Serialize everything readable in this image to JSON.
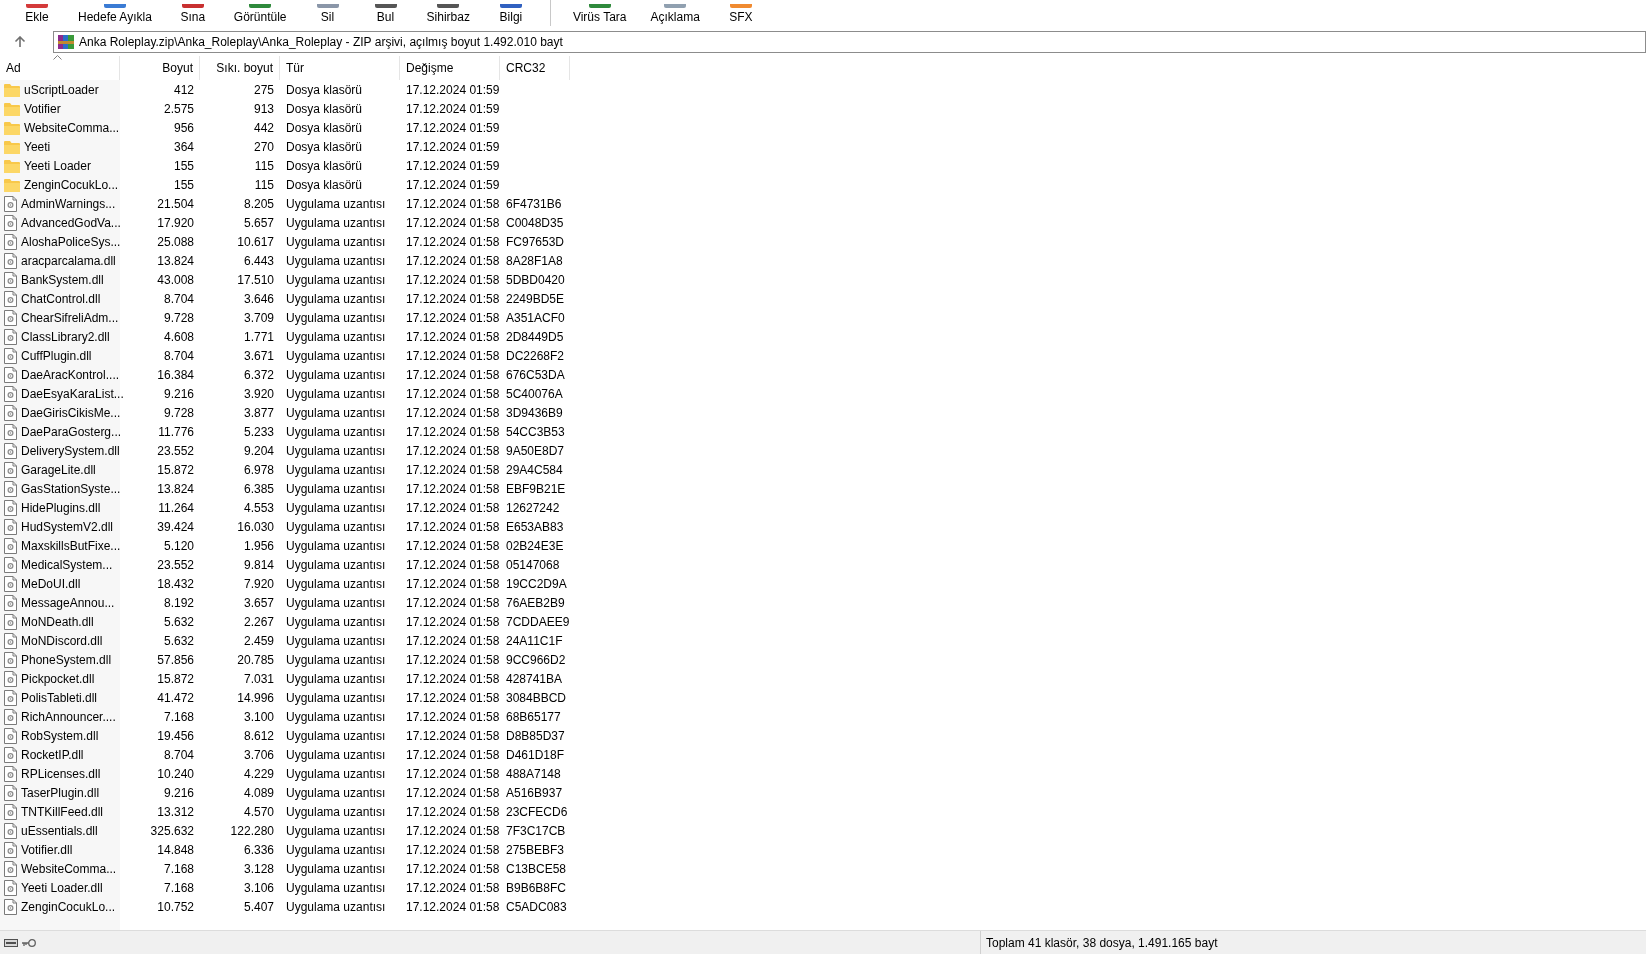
{
  "toolbar": [
    {
      "label": "Ekle"
    },
    {
      "label": "Hedefe Ayıkla"
    },
    {
      "label": "Sına"
    },
    {
      "label": "Görüntüle"
    },
    {
      "label": "Sil"
    },
    {
      "label": "Bul"
    },
    {
      "label": "Sihirbaz"
    },
    {
      "label": "Bilgi"
    },
    {
      "label": "Virüs Tara"
    },
    {
      "label": "Açıklama"
    },
    {
      "label": "SFX"
    }
  ],
  "address": {
    "path": "Anka Roleplay.zip\\Anka_Roleplay\\Anka_Roleplay - ZIP arşivi, açılmış boyut 1.492.010 bayt"
  },
  "table": {
    "columns": [
      {
        "label": "Ad",
        "sorted": true
      },
      {
        "label": "Boyut",
        "sorted": false
      },
      {
        "label": "Sıkı. boyut",
        "sorted": false
      },
      {
        "label": "Tür",
        "sorted": false
      },
      {
        "label": "Değişme",
        "sorted": false
      },
      {
        "label": "CRC32",
        "sorted": false
      }
    ],
    "rows": [
      {
        "kind": "folder",
        "name": "uScriptLoader",
        "size": "412",
        "packed": "275",
        "type": "Dosya klasörü",
        "modified": "17.12.2024 01:59"
      },
      {
        "kind": "folder",
        "name": "Votifier",
        "size": "2.575",
        "packed": "913",
        "type": "Dosya klasörü",
        "modified": "17.12.2024 01:59"
      },
      {
        "kind": "folder",
        "name": "WebsiteComma...",
        "size": "956",
        "packed": "442",
        "type": "Dosya klasörü",
        "modified": "17.12.2024 01:59"
      },
      {
        "kind": "folder",
        "name": "Yeeti",
        "size": "364",
        "packed": "270",
        "type": "Dosya klasörü",
        "modified": "17.12.2024 01:59"
      },
      {
        "kind": "folder",
        "name": "Yeeti Loader",
        "size": "155",
        "packed": "115",
        "type": "Dosya klasörü",
        "modified": "17.12.2024 01:59"
      },
      {
        "kind": "folder",
        "name": "ZenginCocukLo...",
        "size": "155",
        "packed": "115",
        "type": "Dosya klasörü",
        "modified": "17.12.2024 01:59"
      },
      {
        "kind": "file",
        "name": "AdminWarnings...",
        "size": "21.504",
        "packed": "8.205",
        "type": "Uygulama uzantısı",
        "modified": "17.12.2024 01:58",
        "crc": "6F4731B6"
      },
      {
        "kind": "file",
        "name": "AdvancedGodVa...",
        "size": "17.920",
        "packed": "5.657",
        "type": "Uygulama uzantısı",
        "modified": "17.12.2024 01:58",
        "crc": "C0048D35"
      },
      {
        "kind": "file",
        "name": "AloshaPoliceSys...",
        "size": "25.088",
        "packed": "10.617",
        "type": "Uygulama uzantısı",
        "modified": "17.12.2024 01:58",
        "crc": "FC97653D"
      },
      {
        "kind": "file",
        "name": "aracparcalama.dll",
        "size": "13.824",
        "packed": "6.443",
        "type": "Uygulama uzantısı",
        "modified": "17.12.2024 01:58",
        "crc": "8A28F1A8"
      },
      {
        "kind": "file",
        "name": "BankSystem.dll",
        "size": "43.008",
        "packed": "17.510",
        "type": "Uygulama uzantısı",
        "modified": "17.12.2024 01:58",
        "crc": "5DBD0420"
      },
      {
        "kind": "file",
        "name": "ChatControl.dll",
        "size": "8.704",
        "packed": "3.646",
        "type": "Uygulama uzantısı",
        "modified": "17.12.2024 01:58",
        "crc": "2249BD5E"
      },
      {
        "kind": "file",
        "name": "ChearSifreliAdm...",
        "size": "9.728",
        "packed": "3.709",
        "type": "Uygulama uzantısı",
        "modified": "17.12.2024 01:58",
        "crc": "A351ACF0"
      },
      {
        "kind": "file",
        "name": "ClassLibrary2.dll",
        "size": "4.608",
        "packed": "1.771",
        "type": "Uygulama uzantısı",
        "modified": "17.12.2024 01:58",
        "crc": "2D8449D5"
      },
      {
        "kind": "file",
        "name": "CuffPlugin.dll",
        "size": "8.704",
        "packed": "3.671",
        "type": "Uygulama uzantısı",
        "modified": "17.12.2024 01:58",
        "crc": "DC2268F2"
      },
      {
        "kind": "file",
        "name": "DaeAracKontrol....",
        "size": "16.384",
        "packed": "6.372",
        "type": "Uygulama uzantısı",
        "modified": "17.12.2024 01:58",
        "crc": "676C53DA"
      },
      {
        "kind": "file",
        "name": "DaeEsyaKaraList...",
        "size": "9.216",
        "packed": "3.920",
        "type": "Uygulama uzantısı",
        "modified": "17.12.2024 01:58",
        "crc": "5C40076A"
      },
      {
        "kind": "file",
        "name": "DaeGirisCikisMe...",
        "size": "9.728",
        "packed": "3.877",
        "type": "Uygulama uzantısı",
        "modified": "17.12.2024 01:58",
        "crc": "3D9436B9"
      },
      {
        "kind": "file",
        "name": "DaeParaGosterg...",
        "size": "11.776",
        "packed": "5.233",
        "type": "Uygulama uzantısı",
        "modified": "17.12.2024 01:58",
        "crc": "54CC3B53"
      },
      {
        "kind": "file",
        "name": "DeliverySystem.dll",
        "size": "23.552",
        "packed": "9.204",
        "type": "Uygulama uzantısı",
        "modified": "17.12.2024 01:58",
        "crc": "9A50E8D7"
      },
      {
        "kind": "file",
        "name": "GarageLite.dll",
        "size": "15.872",
        "packed": "6.978",
        "type": "Uygulama uzantısı",
        "modified": "17.12.2024 01:58",
        "crc": "29A4C584"
      },
      {
        "kind": "file",
        "name": "GasStationSyste...",
        "size": "13.824",
        "packed": "6.385",
        "type": "Uygulama uzantısı",
        "modified": "17.12.2024 01:58",
        "crc": "EBF9B21E"
      },
      {
        "kind": "file",
        "name": "HidePlugins.dll",
        "size": "11.264",
        "packed": "4.553",
        "type": "Uygulama uzantısı",
        "modified": "17.12.2024 01:58",
        "crc": "12627242"
      },
      {
        "kind": "file",
        "name": "HudSystemV2.dll",
        "size": "39.424",
        "packed": "16.030",
        "type": "Uygulama uzantısı",
        "modified": "17.12.2024 01:58",
        "crc": "E653AB83"
      },
      {
        "kind": "file",
        "name": "MaxskillsButFixe...",
        "size": "5.120",
        "packed": "1.956",
        "type": "Uygulama uzantısı",
        "modified": "17.12.2024 01:58",
        "crc": "02B24E3E"
      },
      {
        "kind": "file",
        "name": "MedicalSystem...",
        "size": "23.552",
        "packed": "9.814",
        "type": "Uygulama uzantısı",
        "modified": "17.12.2024 01:58",
        "crc": "05147068"
      },
      {
        "kind": "file",
        "name": "MeDoUI.dll",
        "size": "18.432",
        "packed": "7.920",
        "type": "Uygulama uzantısı",
        "modified": "17.12.2024 01:58",
        "crc": "19CC2D9A"
      },
      {
        "kind": "file",
        "name": "MessageAnnou...",
        "size": "8.192",
        "packed": "3.657",
        "type": "Uygulama uzantısı",
        "modified": "17.12.2024 01:58",
        "crc": "76AEB2B9"
      },
      {
        "kind": "file",
        "name": "MoNDeath.dll",
        "size": "5.632",
        "packed": "2.267",
        "type": "Uygulama uzantısı",
        "modified": "17.12.2024 01:58",
        "crc": "7CDDAEE9"
      },
      {
        "kind": "file",
        "name": "MoNDiscord.dll",
        "size": "5.632",
        "packed": "2.459",
        "type": "Uygulama uzantısı",
        "modified": "17.12.2024 01:58",
        "crc": "24A11C1F"
      },
      {
        "kind": "file",
        "name": "PhoneSystem.dll",
        "size": "57.856",
        "packed": "20.785",
        "type": "Uygulama uzantısı",
        "modified": "17.12.2024 01:58",
        "crc": "9CC966D2"
      },
      {
        "kind": "file",
        "name": "Pickpocket.dll",
        "size": "15.872",
        "packed": "7.031",
        "type": "Uygulama uzantısı",
        "modified": "17.12.2024 01:58",
        "crc": "428741BA"
      },
      {
        "kind": "file",
        "name": "PolisTableti.dll",
        "size": "41.472",
        "packed": "14.996",
        "type": "Uygulama uzantısı",
        "modified": "17.12.2024 01:58",
        "crc": "3084BBCD"
      },
      {
        "kind": "file",
        "name": "RichAnnouncer....",
        "size": "7.168",
        "packed": "3.100",
        "type": "Uygulama uzantısı",
        "modified": "17.12.2024 01:58",
        "crc": "68B65177"
      },
      {
        "kind": "file",
        "name": "RobSystem.dll",
        "size": "19.456",
        "packed": "8.612",
        "type": "Uygulama uzantısı",
        "modified": "17.12.2024 01:58",
        "crc": "D8B85D37"
      },
      {
        "kind": "file",
        "name": "RocketIP.dll",
        "size": "8.704",
        "packed": "3.706",
        "type": "Uygulama uzantısı",
        "modified": "17.12.2024 01:58",
        "crc": "D461D18F"
      },
      {
        "kind": "file",
        "name": "RPLicenses.dll",
        "size": "10.240",
        "packed": "4.229",
        "type": "Uygulama uzantısı",
        "modified": "17.12.2024 01:58",
        "crc": "488A7148"
      },
      {
        "kind": "file",
        "name": "TaserPlugin.dll",
        "size": "9.216",
        "packed": "4.089",
        "type": "Uygulama uzantısı",
        "modified": "17.12.2024 01:58",
        "crc": "A516B937"
      },
      {
        "kind": "file",
        "name": "TNTKillFeed.dll",
        "size": "13.312",
        "packed": "4.570",
        "type": "Uygulama uzantısı",
        "modified": "17.12.2024 01:58",
        "crc": "23CFECD6"
      },
      {
        "kind": "file",
        "name": "uEssentials.dll",
        "size": "325.632",
        "packed": "122.280",
        "type": "Uygulama uzantısı",
        "modified": "17.12.2024 01:58",
        "crc": "7F3C17CB"
      },
      {
        "kind": "file",
        "name": "Votifier.dll",
        "size": "14.848",
        "packed": "6.336",
        "type": "Uygulama uzantısı",
        "modified": "17.12.2024 01:58",
        "crc": "275BEBF3"
      },
      {
        "kind": "file",
        "name": "WebsiteComma...",
        "size": "7.168",
        "packed": "3.128",
        "type": "Uygulama uzantısı",
        "modified": "17.12.2024 01:58",
        "crc": "C13BCE58"
      },
      {
        "kind": "file",
        "name": "Yeeti Loader.dll",
        "size": "7.168",
        "packed": "3.106",
        "type": "Uygulama uzantısı",
        "modified": "17.12.2024 01:58",
        "crc": "B9B6B8FC"
      },
      {
        "kind": "file",
        "name": "ZenginCocukLo...",
        "size": "10.752",
        "packed": "5.407",
        "type": "Uygulama uzantısı",
        "modified": "17.12.2024 01:58",
        "crc": "C5ADC083"
      }
    ]
  },
  "status_bar": {
    "text": "Toplam 41 klasör, 38 dosya, 1.491.165 bayt"
  }
}
